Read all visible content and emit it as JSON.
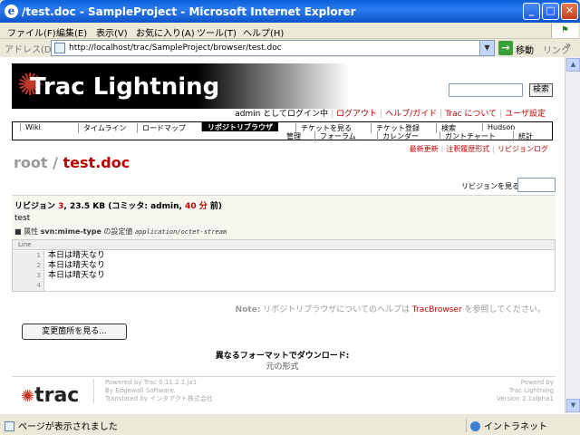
{
  "window": {
    "title": "/test.doc - SampleProject - Microsoft Internet Explorer",
    "min": "_",
    "max": "□",
    "close": "✕"
  },
  "menu": [
    "ファイル(F)",
    "編集(E)",
    "表示(V)",
    "お気に入り(A)",
    "ツール(T)",
    "ヘルプ(H)"
  ],
  "address": {
    "label": "アドレス(D)",
    "url": "http://localhost/trac/SampleProject/browser/test.doc",
    "go": "移動",
    "links": "リンク"
  },
  "banner": {
    "logo_text": "Trac Lightning"
  },
  "search": {
    "button": "検索"
  },
  "metanav": {
    "user": "admin としてログイン中",
    "logout": "ログアウト",
    "help": "ヘルプ/ガイド",
    "about": "Trac について",
    "prefs": "ユーザ設定"
  },
  "mainnav": {
    "wiki": "Wiki",
    "timeline": "タイムライン",
    "roadmap": "ロードマップ",
    "browser": "リポジトリブラウザ",
    "tickets": "チケットを見る",
    "newticket": "チケット登録",
    "search": "検索",
    "hudson": "Hudson",
    "admin": "管理",
    "forum": "フォーラム",
    "calendar": "カレンダー",
    "gantt": "ガントチャート",
    "stats": "統計"
  },
  "ctxtnav": {
    "latest": "最新更新",
    "annotate": "注釈履歴形式",
    "log": "リビジョンログ"
  },
  "path": {
    "root": "root",
    "sep": " / ",
    "file": "test.doc"
  },
  "rev_view": {
    "label": "リビジョンを見る:"
  },
  "info": {
    "prefix": "リビジョン ",
    "rev": "3",
    "size": ", 23.5 KB (コミッタ: admin, ",
    "age": "40 分",
    "suffix": " 前)",
    "message": "test",
    "prop_bullet": "■ 属性 ",
    "prop_name": "svn:mime-type",
    "prop_mid": " の設定値 ",
    "prop_value": "application/octet-stream"
  },
  "code": {
    "header": "Line",
    "lines": [
      {
        "n": "1",
        "text": "本日は晴天なり"
      },
      {
        "n": "2",
        "text": "本日は晴天なり"
      },
      {
        "n": "3",
        "text": "本日は晴天なり"
      },
      {
        "n": "4",
        "text": ""
      }
    ]
  },
  "note": {
    "label": "Note:",
    "pre": " リポジトリブラウザについてのヘルプは ",
    "link": "TracBrowser",
    "post": " を参照してください。"
  },
  "diff_button": "変更箇所を見る...",
  "alt_formats": {
    "title": "異なるフォーマットでダウンロード:",
    "original": "元の形式"
  },
  "footer": {
    "logo": "trac",
    "powered1": "Powered by Trac 0.11.2.1.ja1",
    "powered2": "By Edgewall Software.",
    "powered3": "Translated by インタアクト株式会社",
    "right1": "Powerd by",
    "right2": "Trac Lightning",
    "right3": "Version 2.1alpha1"
  },
  "status": {
    "text": "ページが表示されました",
    "zone": "イントラネット"
  }
}
